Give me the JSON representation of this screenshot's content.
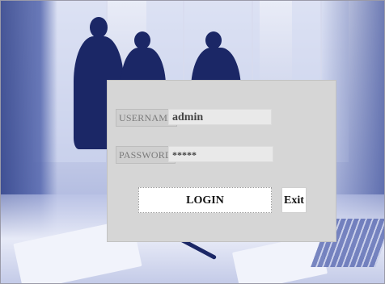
{
  "login_form": {
    "username_label": "USERNAME",
    "username_value": "admin",
    "password_label": "PASSWORD",
    "password_value": "*****",
    "login_label": "LOGIN",
    "exit_label": "Exit"
  },
  "colors": {
    "dialog_bg": "#d6d6d6",
    "background_tint": "#1b2766"
  }
}
